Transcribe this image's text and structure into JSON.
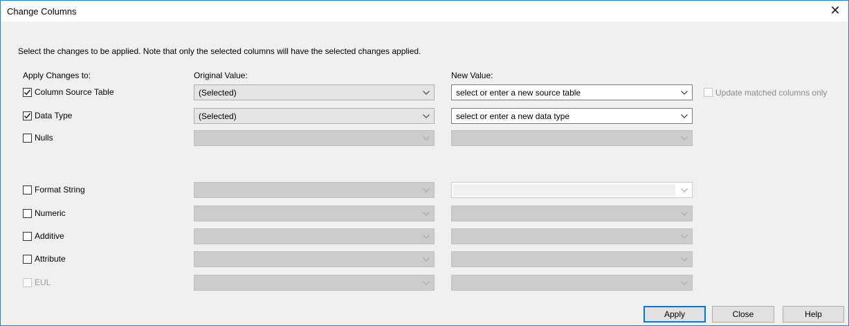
{
  "window": {
    "title": "Change Columns"
  },
  "instructions": "Select the changes to be applied. Note that only the selected columns will have the selected changes applied.",
  "headers": {
    "apply_to": "Apply Changes to:",
    "original": "Original Value:",
    "new": "New Value:"
  },
  "rows": [
    {
      "label": "Column Source Table",
      "checked": true,
      "original": "(Selected)",
      "new_placeholder": "select or enter a new source table"
    },
    {
      "label": "Data Type",
      "checked": true,
      "original": "(Selected)",
      "new_placeholder": "select or enter a new data type"
    },
    {
      "label": "Nulls",
      "checked": false,
      "original": "",
      "new_placeholder": ""
    },
    {
      "label": "Format String",
      "checked": false,
      "original": "",
      "new_placeholder": ""
    },
    {
      "label": "Numeric",
      "checked": false,
      "original": "",
      "new_placeholder": ""
    },
    {
      "label": "Additive",
      "checked": false,
      "original": "",
      "new_placeholder": ""
    },
    {
      "label": "Attribute",
      "checked": false,
      "original": "",
      "new_placeholder": ""
    },
    {
      "label": "EUL",
      "checked": false,
      "disabled": true,
      "original": "",
      "new_placeholder": ""
    }
  ],
  "update_matched": {
    "label": "Update matched columns only",
    "checked": false,
    "disabled": true
  },
  "buttons": {
    "apply": "Apply",
    "close": "Close",
    "help": "Help"
  },
  "icons": {
    "close": "close-icon",
    "dropdown": "chevron-down-icon",
    "check": "checkmark-icon"
  }
}
